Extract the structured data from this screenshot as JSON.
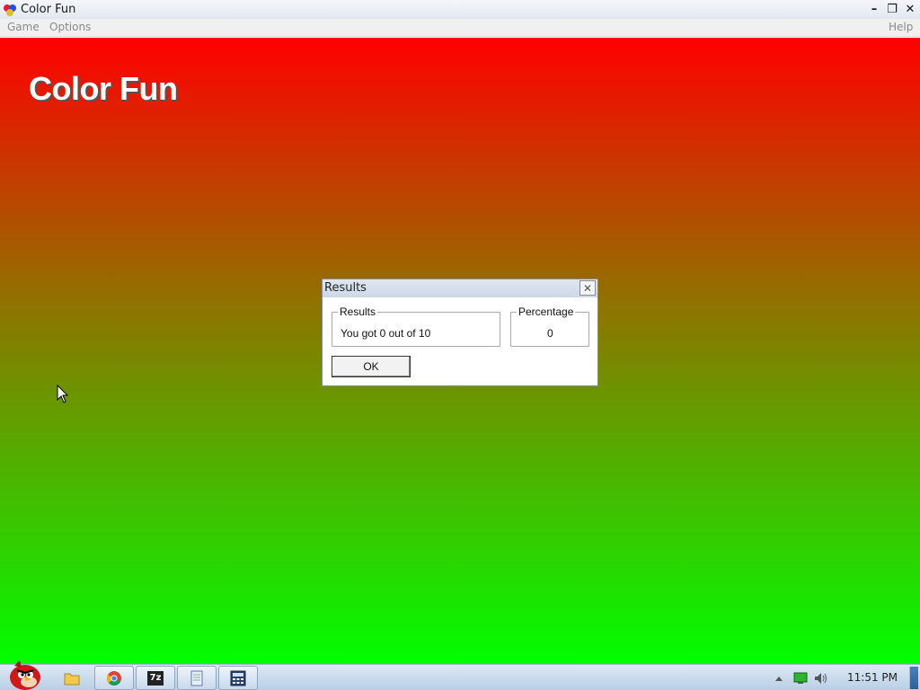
{
  "window": {
    "title": "Color Fun",
    "minimize_glyph": "–",
    "maximize_glyph": "❐",
    "close_glyph": "✕"
  },
  "menu": {
    "game": "Game",
    "options": "Options",
    "help": "Help"
  },
  "game": {
    "title": "Color Fun",
    "gradient_top": "#ff0000",
    "gradient_bottom": "#00ff00"
  },
  "dialog": {
    "title": "Results",
    "close_glyph": "✕",
    "results_label": "Results",
    "results_value": "You got 0 out of 10",
    "percentage_label": "Percentage",
    "percentage_value": "0",
    "ok_label": "OK"
  },
  "taskbar": {
    "start_icon": "angry-bird-start-icon",
    "pinned": [
      {
        "name": "folder-icon"
      },
      {
        "name": "chrome-icon"
      },
      {
        "name": "7zip-icon",
        "label": "7z"
      },
      {
        "name": "notepad-icon"
      },
      {
        "name": "calculator-icon"
      }
    ],
    "clock": "11:51 PM"
  }
}
